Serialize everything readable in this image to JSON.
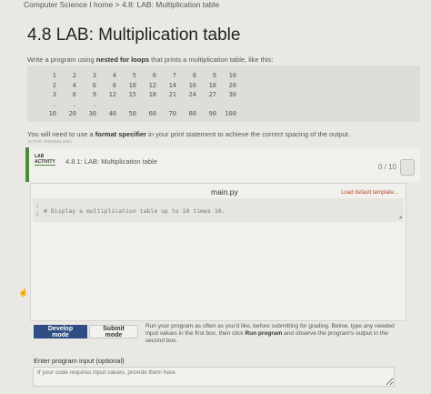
{
  "breadcrumb": "Computer Science I home > 4.8: LAB: Multiplication table",
  "page": {
    "title": "4.8 LAB: Multiplication table",
    "description_prefix": "Write a program using ",
    "description_bold": "nested for loops",
    "description_suffix": " that prints a multiplication table, like this:",
    "example_rows": [
      [
        "1",
        "2",
        "3",
        "4",
        "5",
        "6",
        "7",
        "8",
        "9",
        "10"
      ],
      [
        "2",
        "4",
        "6",
        "8",
        "10",
        "12",
        "14",
        "16",
        "18",
        "20"
      ],
      [
        "3",
        "6",
        "9",
        "12",
        "15",
        "18",
        "21",
        "24",
        "27",
        "30"
      ],
      [
        ".",
        ".",
        "."
      ],
      [
        "10",
        "20",
        "30",
        "40",
        "50",
        "60",
        "70",
        "80",
        "90",
        "100"
      ]
    ],
    "note_prefix": "You will need to use a ",
    "note_bold": "format specifier",
    "note_suffix": " in your print statement to achieve the correct spacing of the output.",
    "note_sub": "ACTIVE 37003691.2051"
  },
  "lab": {
    "tag_line1": "LAB",
    "tag_line2": "ACTIVITY",
    "name": "4.8.1: LAB: Multiplication table",
    "score": "0 / 10"
  },
  "editor": {
    "file_name": "main.py",
    "load_template": "Load default template...",
    "gutter_1": "1",
    "gutter_2": "2",
    "code_line": "# Display a multiplication table up to 10 times 10."
  },
  "buttons": {
    "develop": "Develop mode",
    "submit": "Submit mode"
  },
  "run_instructions": {
    "part1": "Run your program as often as you'd like, before submitting for grading. Below, type any needed input values in the first box, then click ",
    "bold": "Run program",
    "part2": " and observe the program's output in the second box."
  },
  "input": {
    "label": "Enter program input (optional)",
    "placeholder": "If your code requires input values, provide them here."
  },
  "colors": {
    "accent_green": "#4d8c3e",
    "button_blue": "#2f4d84",
    "link_red": "#c0462a"
  }
}
